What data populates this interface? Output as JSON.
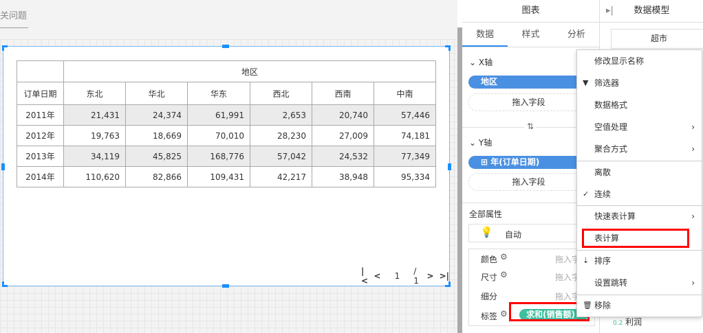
{
  "canvas": {
    "title": "关问题"
  },
  "table": {
    "corner": "",
    "region_header": "地区",
    "row_header": "订单日期",
    "columns": [
      "东北",
      "华北",
      "华东",
      "西北",
      "西南",
      "中南"
    ],
    "rows": [
      {
        "year": "2011年",
        "values": [
          "21,431",
          "24,374",
          "61,991",
          "2,653",
          "20,740",
          "57,446"
        ]
      },
      {
        "year": "2012年",
        "values": [
          "19,763",
          "18,669",
          "70,010",
          "28,230",
          "27,009",
          "74,181"
        ]
      },
      {
        "year": "2013年",
        "values": [
          "34,119",
          "45,825",
          "168,776",
          "57,042",
          "24,532",
          "77,349"
        ]
      },
      {
        "year": "2014年",
        "values": [
          "110,620",
          "82,866",
          "109,431",
          "42,217",
          "38,948",
          "95,334"
        ]
      }
    ]
  },
  "pager": {
    "first": "|<",
    "prev": "<",
    "page": "1",
    "total": "/ 1",
    "next": ">",
    "last": ">|"
  },
  "panel": {
    "title": "图表",
    "tabs": [
      "数据",
      "样式",
      "分析"
    ],
    "x_axis": "X轴",
    "x_field": "地区",
    "drop": "拖入字段",
    "swap": "⇅",
    "y_axis": "Y轴",
    "y_field": "年(订单日期)",
    "all_props": "全部属性",
    "auto": "自动",
    "props": [
      {
        "label": "颜色",
        "drop": "拖入字"
      },
      {
        "label": "尺寸",
        "drop": "拖入字"
      },
      {
        "label": "细分",
        "drop": "拖入字"
      },
      {
        "label": "标签",
        "field": "求和(销售额)"
      }
    ]
  },
  "right": {
    "title": "数据模型",
    "dataset": "超市",
    "field_prefix": "0.2",
    "field": "利润"
  },
  "menu": [
    "修改显示名称",
    "筛选器",
    "数据格式",
    "空值处理",
    "聚合方式",
    "离散",
    "连续",
    "快速表计算",
    "表计算",
    "排序",
    "设置跳转",
    "移除"
  ]
}
